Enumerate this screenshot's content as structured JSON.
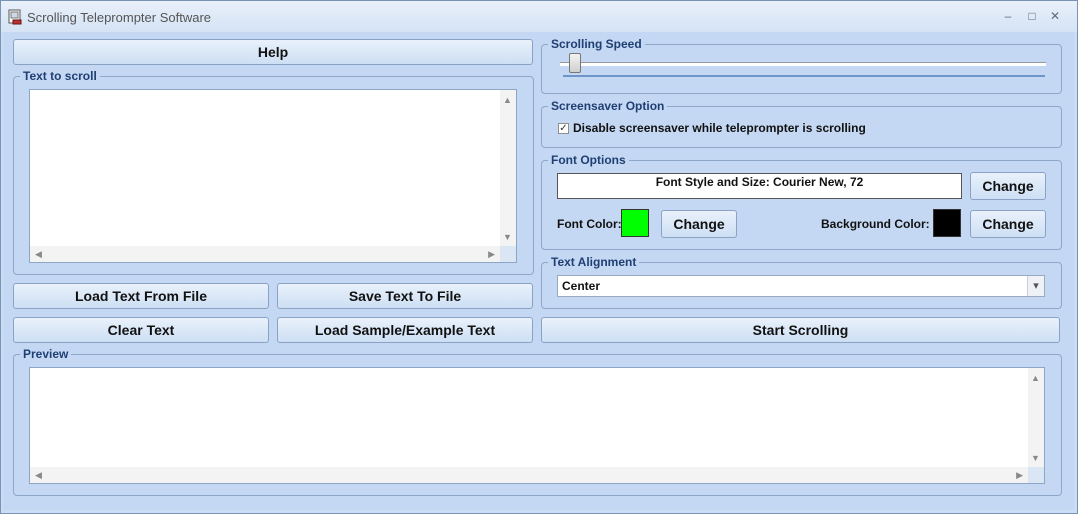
{
  "window": {
    "title": "Scrolling Teleprompter Software",
    "minimize_glyph": "–",
    "maximize_glyph": "□",
    "close_glyph": "✕"
  },
  "buttons": {
    "help": "Help",
    "load_text": "Load Text From File",
    "save_text": "Save Text To File",
    "clear_text": "Clear Text",
    "load_sample": "Load Sample/Example Text",
    "start_scrolling": "Start Scrolling"
  },
  "text_to_scroll": {
    "label": "Text to scroll",
    "value": ""
  },
  "scrolling_speed": {
    "label": "Scrolling Speed",
    "value_fraction": 0.02
  },
  "screensaver": {
    "label": "Screensaver Option",
    "checkbox_label": "Disable screensaver while teleprompter is scrolling",
    "checked": true
  },
  "font_options": {
    "label": "Font Options",
    "font_style_text": "Font Style and Size: Courier New, 72",
    "change_label": "Change",
    "font_color_label": "Font Color:",
    "font_color": "#00ff00",
    "background_color_label": "Background Color:",
    "background_color": "#000000"
  },
  "text_alignment": {
    "label": "Text Alignment",
    "selected": "Center"
  },
  "preview": {
    "label": "Preview",
    "value": ""
  },
  "icons": {
    "app": "app-icon",
    "scroll_up": "▲",
    "scroll_down": "▼",
    "scroll_left": "◀",
    "scroll_right": "▶",
    "dropdown": "▾",
    "check": "✓"
  }
}
